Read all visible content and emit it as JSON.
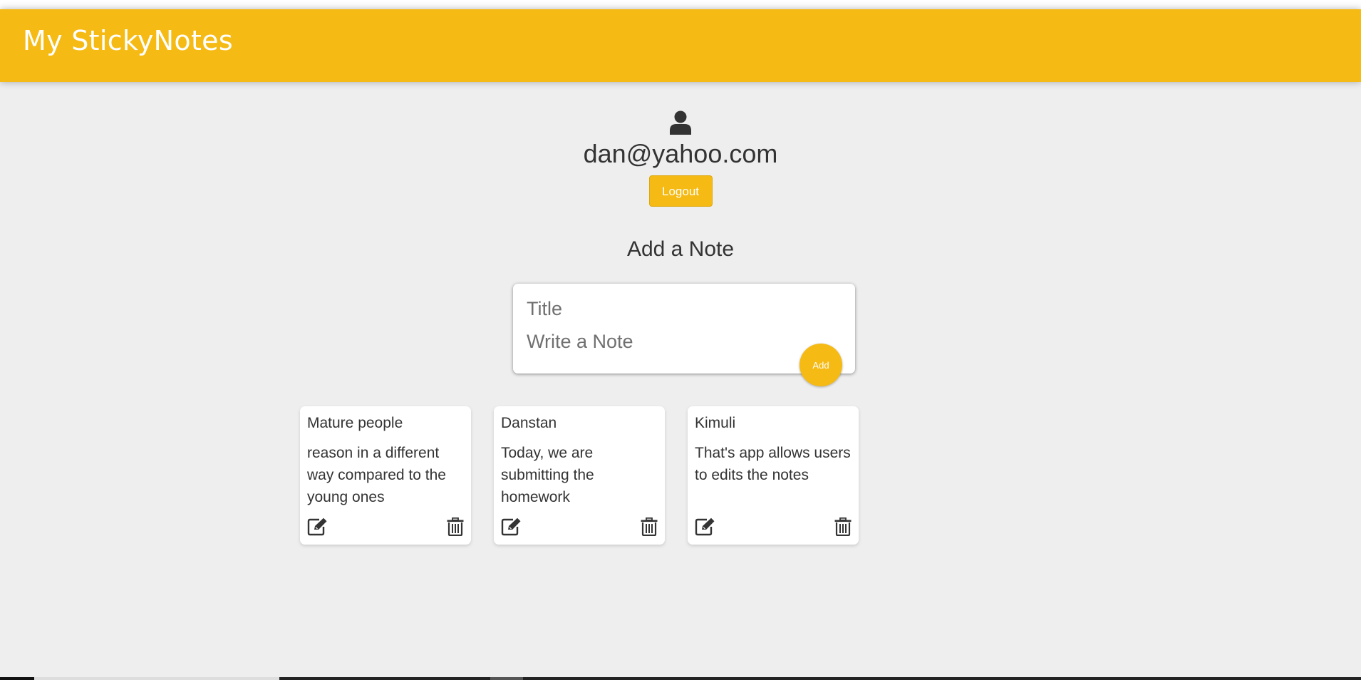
{
  "app": {
    "title": "My StickyNotes"
  },
  "user": {
    "email": "dan@yahoo.com",
    "icon": "user-icon",
    "logout_label": "Logout"
  },
  "form": {
    "heading": "Add a Note",
    "title_placeholder": "Title",
    "content_placeholder": "Write a Note",
    "add_label": "Add"
  },
  "notes": [
    {
      "title": "Mature people",
      "content": "reason in a different way compared to the young ones",
      "edit_icon": "edit-icon",
      "delete_icon": "trash-icon"
    },
    {
      "title": "Danstan",
      "content": "Today, we are submitting the homework",
      "edit_icon": "edit-icon",
      "delete_icon": "trash-icon"
    },
    {
      "title": "Kimuli",
      "content": "That's app allows users to edits the notes",
      "edit_icon": "edit-icon",
      "delete_icon": "trash-icon"
    }
  ],
  "colors": {
    "accent": "#f5ba13",
    "background": "#eeeeee",
    "text": "#333333"
  }
}
